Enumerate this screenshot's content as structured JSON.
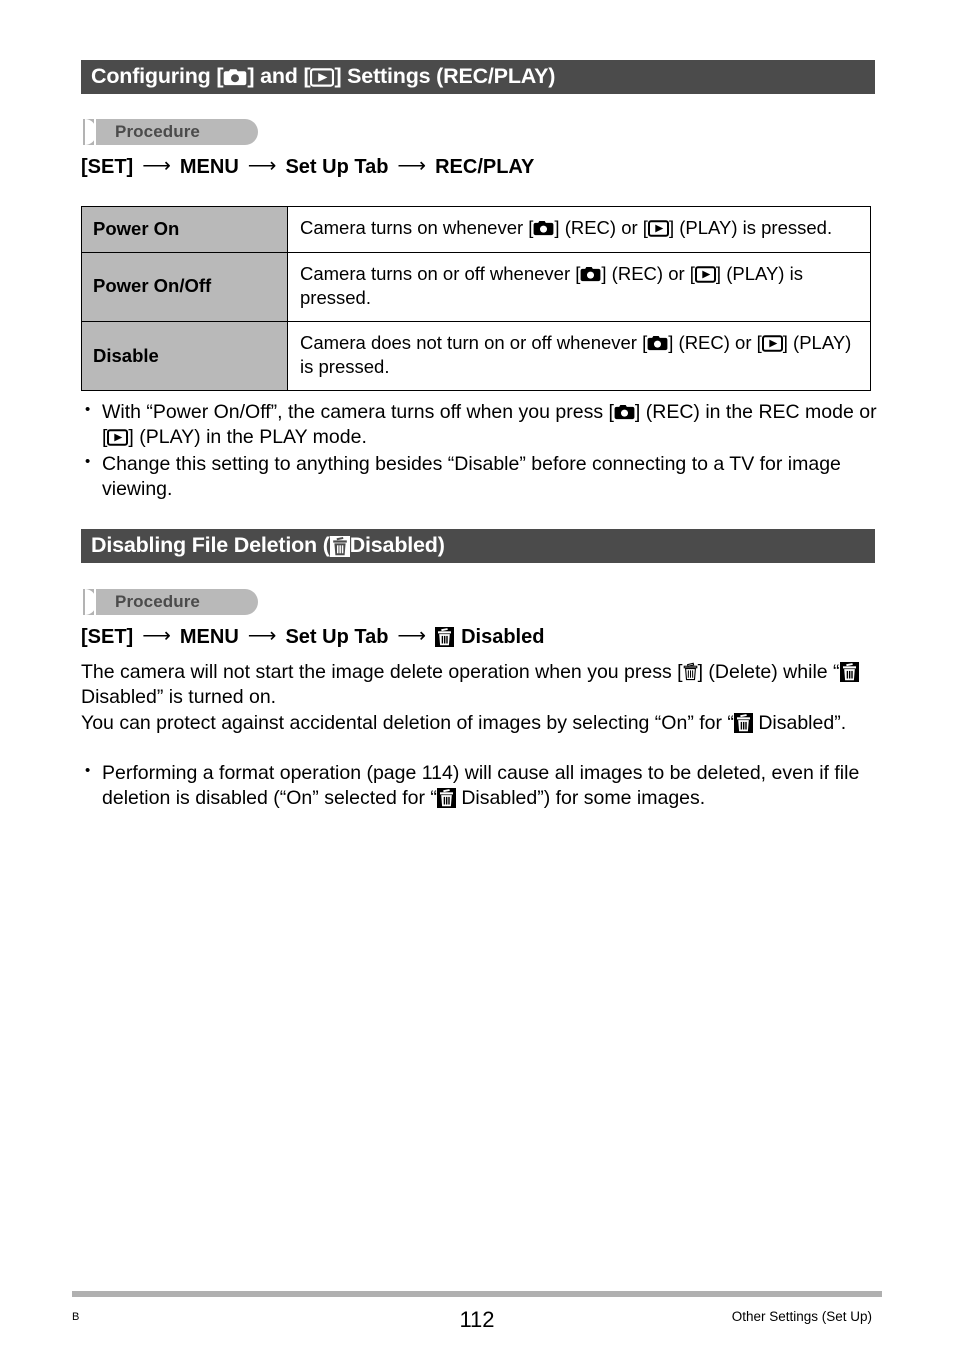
{
  "page": {
    "number": "112",
    "left_mark": "B",
    "footer_right": "Other Settings (Set Up)"
  },
  "colors": {
    "header_bar": "#4b4b4b",
    "header_text": "#ffffff",
    "badge_pill": "#b9b9b9",
    "badge_bar": "#b3b3b3",
    "badge_text": "#4b4b4b",
    "table_key_bg": "#b9b9b9",
    "table_border": "#000000",
    "footer_rule": "#b0b0b0",
    "body_text": "#000000"
  },
  "sections": [
    {
      "id": "rec-play",
      "heading": {
        "part1": "Configuring [",
        "icon1": "camera-icon",
        "part2": "] and [",
        "icon2": "play-icon",
        "part3": "] Settings (REC/PLAY)"
      },
      "procedure_label": "Procedure",
      "nav": {
        "items": [
          "[SET]",
          "MENU",
          "Set Up Tab",
          "REC/PLAY"
        ],
        "separator": "⟶"
      },
      "table": {
        "rows": [
          {
            "key": "Power On",
            "value_pre": "Camera turns on whenever [",
            "value_mid": "] (REC) or [",
            "value_post": "] (PLAY) is pressed.",
            "icon1": "camera-icon",
            "icon2": "play-icon"
          },
          {
            "key": "Power On/Off",
            "value_pre": "Camera turns on or off whenever [",
            "value_mid": "] (REC) or [",
            "value_post": "] (PLAY) is pressed.",
            "icon1": "camera-icon",
            "icon2": "play-icon"
          },
          {
            "key": "Disable",
            "value_pre": "Camera does not turn on or off whenever [",
            "value_mid": "] (REC) or [",
            "value_post": "] (PLAY) is pressed.",
            "icon1": "camera-icon",
            "icon2": "play-icon"
          }
        ]
      },
      "bullets": [
        {
          "a": "With “Power On/Off”, the camera turns off when you press [",
          "icon1": "camera-icon",
          "b": "] (REC) in the REC mode or [",
          "icon2": "play-icon",
          "c": "] (PLAY) in the PLAY mode."
        },
        {
          "a": "Change this setting to anything besides “Disable” before connecting to a TV for image viewing."
        }
      ]
    },
    {
      "id": "file-deletion",
      "heading": {
        "part1": "Disabling File Deletion (",
        "icon1": "trash-icon",
        "part3": " Disabled)"
      },
      "procedure_label": "Procedure",
      "nav": {
        "items": [
          "[SET]",
          "MENU",
          "Set Up Tab",
          "Disabled"
        ],
        "separator": "⟶",
        "last_icon": "trash-icon"
      },
      "paragraphs": [
        {
          "a": "The camera will not start the image delete operation when you press [",
          "icon1": "trash-outline-icon",
          "b": "] (Delete) while “",
          "icon2": "trash-icon",
          "c": " Disabled” is turned on."
        },
        {
          "a": "You can protect against accidental deletion of images by selecting “On” for “",
          "icon1": "trash-icon",
          "b": " Disabled”."
        }
      ],
      "bullets": [
        {
          "a": "Performing a format operation (page 114) will cause all images to be deleted, even if file deletion is disabled (“On” selected for “",
          "icon1": "trash-icon",
          "b": " Disabled”) for some images."
        }
      ]
    }
  ]
}
